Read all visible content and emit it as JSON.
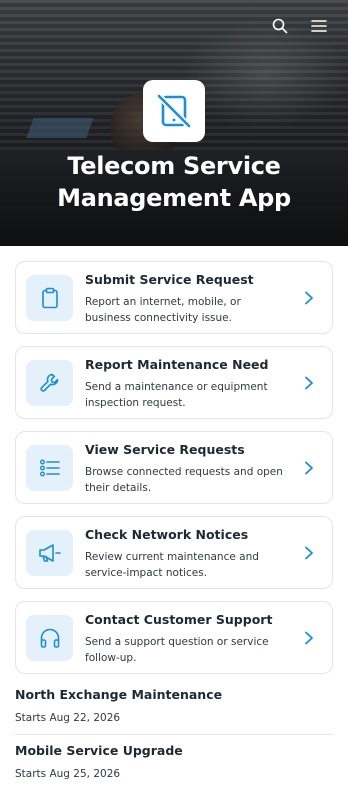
{
  "app": {
    "title": "Telecom Service Management App",
    "title_line1": "Telecom Service",
    "title_line2": "Management App",
    "accent_color": "#1a8fd8",
    "logo_icon": "no-mobile-icon"
  },
  "header": {
    "search_icon": "search-icon",
    "menu_icon": "hamburger-menu-icon"
  },
  "actions": [
    {
      "title": "Submit Service Request",
      "description": "Report an internet, mobile, or business connectivity issue.",
      "icon": "clipboard-icon"
    },
    {
      "title": "Report Maintenance Need",
      "description": "Send a maintenance or equipment inspection request.",
      "icon": "wrench-icon"
    },
    {
      "title": "View Service Requests",
      "description": "Browse connected requests and open their details.",
      "icon": "list-icon"
    },
    {
      "title": "Check Network Notices",
      "description": "Review current maintenance and service-impact notices.",
      "icon": "megaphone-icon"
    },
    {
      "title": "Contact Customer Support",
      "description": "Send a support question or service follow-up.",
      "icon": "headset-icon"
    }
  ],
  "notices": [
    {
      "title": "North Exchange Maintenance",
      "date": "Starts Aug 22, 2026"
    },
    {
      "title": "Mobile Service Upgrade",
      "date": "Starts Aug 25, 2026"
    }
  ]
}
